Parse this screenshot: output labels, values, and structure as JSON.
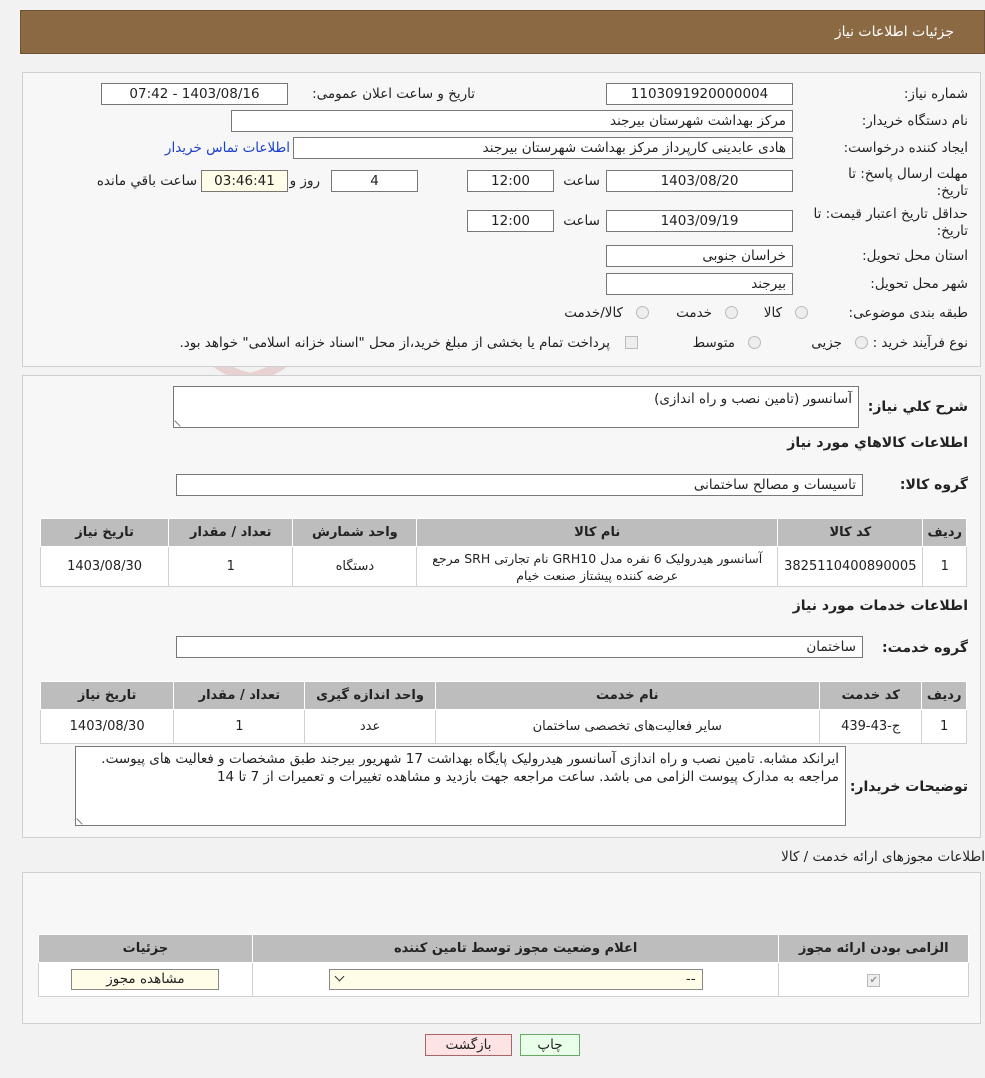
{
  "header": {
    "title": "جزئیات اطلاعات نیاز"
  },
  "form": {
    "need_number_label": "شماره نیاز:",
    "need_number": "1103091920000004",
    "announce_label": "تاریخ و ساعت اعلان عمومی:",
    "announce_value": "1403/08/16 - 07:42",
    "buyer_org_label": "نام دستگاه خریدار:",
    "buyer_org": "مرکز بهداشت شهرستان بیرجند",
    "creator_label": "ایجاد کننده درخواست:",
    "creator": "هادی عابدینی کارپرداز مرکز بهداشت شهرستان بیرجند",
    "contact_link": "اطلاعات تماس خریدار",
    "deadline_label": "مهلت ارسال پاسخ: تا تاریخ:",
    "deadline_date": "1403/08/20",
    "time_label": "ساعت",
    "deadline_time": "12:00",
    "days_value": "4",
    "days_label": "روز و",
    "remaining_time": "03:46:41",
    "remaining_label": "ساعت باقي مانده",
    "validity_label": "حداقل تاریخ اعتبار قیمت: تا تاریخ:",
    "validity_date": "1403/09/19",
    "validity_time": "12:00",
    "province_label": "استان محل تحویل:",
    "province": "خراسان جنوبی",
    "city_label": "شهر محل تحویل:",
    "city": "بیرجند",
    "category_label": "طبقه بندی موضوعی:",
    "category_options": [
      "کالا",
      "خدمت",
      "کالا/خدمت"
    ],
    "process_label": "نوع فرآیند خرید :",
    "process_options": [
      "جزیی",
      "متوسط"
    ],
    "process_note": "پرداخت تمام یا بخشی از مبلغ خرید،از محل \"اسناد خزانه اسلامی\" خواهد بود."
  },
  "general": {
    "desc_label": "شرح کلي نياز:",
    "desc": "آسانسور (تامین نصب و راه اندازی)",
    "goods_title": "اطلاعات کالاهاي مورد نياز",
    "goods_group_label": "گروه کالا:",
    "goods_group": "تاسیسات و مصالح ساختمانی",
    "goods_headers": [
      "ردیف",
      "کد کالا",
      "نام کالا",
      "واحد شمارش",
      "تعداد / مقدار",
      "تاریخ نیاز"
    ],
    "goods_rows": [
      [
        "1",
        "3825110400890005",
        "آسانسور هیدرولیک 6 نفره مدل GRH10 نام تجارتی SRH مرجع عرضه کننده پیشتاز صنعت خیام",
        "دستگاه",
        "1",
        "1403/08/30"
      ]
    ],
    "services_title": "اطلاعات خدمات مورد نياز",
    "service_group_label": "گروه خدمت:",
    "service_group": "ساختمان",
    "services_headers": [
      "ردیف",
      "کد خدمت",
      "نام خدمت",
      "واحد اندازه گیری",
      "تعداد / مقدار",
      "تاریخ نیاز"
    ],
    "services_rows": [
      [
        "1",
        "ج-43-439",
        "سایر فعالیت‌های تخصصی ساختمان",
        "عدد",
        "1",
        "1403/08/30"
      ]
    ],
    "buyer_notes_label": "توضیحات خریدار:",
    "buyer_notes": "ایرانکد مشابه. تامین نصب و راه اندازی آسانسور هیدرولیک پایگاه بهداشت 17 شهریور بیرجند طبق مشخصات و فعالیت های پیوست. مراجعه به مدارک پیوست الزامی می باشد. ساعت مراجعه جهت بازدید و مشاهده تغییرات و تعمیرات از 7 تا 14"
  },
  "permits": {
    "title": "اطلاعات مجوزهای ارائه خدمت / کالا",
    "headers": [
      "الزامی بودن ارائه مجوز",
      "اعلام وضعیت مجوز توسط تامین کننده",
      "جزئیات"
    ],
    "select_value": "--",
    "view_button": "مشاهده مجوز"
  },
  "actions": {
    "print": "چاپ",
    "back": "بازگشت"
  },
  "watermark": {
    "text": "AriaTender.neT"
  },
  "colors": {
    "header_bg": "#8b6a43",
    "table_header": "#bdbdbd",
    "link": "#1a3fcf",
    "back_button": "#fde3e3",
    "print_button": "#eaffea"
  }
}
